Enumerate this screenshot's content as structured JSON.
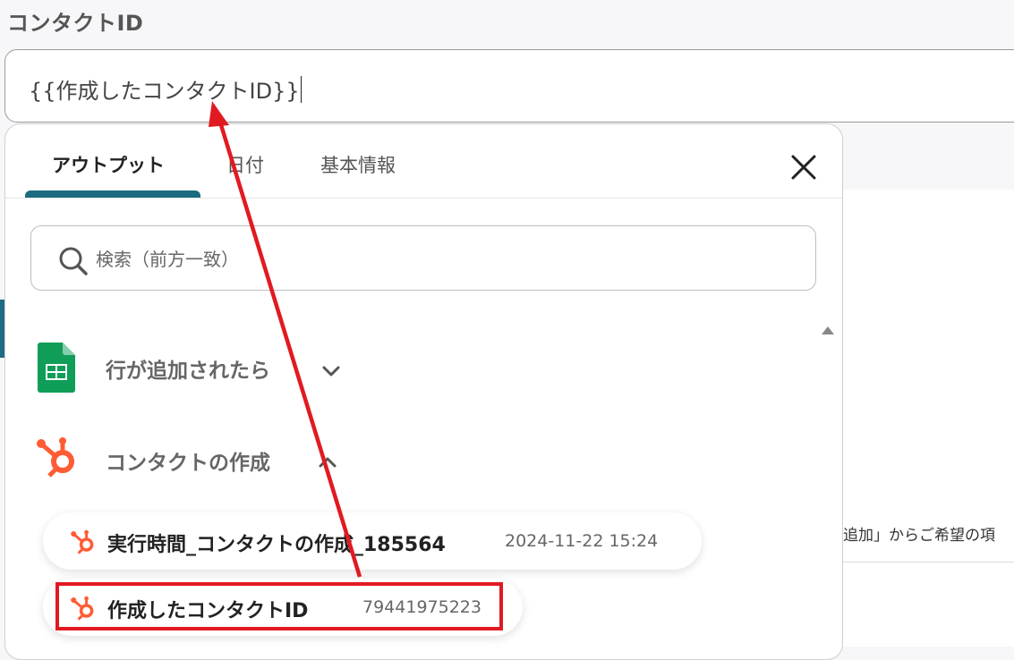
{
  "field": {
    "label": "コンタクトID",
    "value": "{{作成したコンタクトID}}"
  },
  "dropdown": {
    "tabs": [
      {
        "label": "アウトプット",
        "active": true
      },
      {
        "label": "日付",
        "active": false
      },
      {
        "label": "基本情報",
        "active": false
      }
    ],
    "search_placeholder": "検索（前方一致）",
    "sections": [
      {
        "title": "行が追加されたら",
        "expanded": false,
        "icon": "google-sheets-icon"
      },
      {
        "title": "コンタクトの作成",
        "expanded": true,
        "icon": "hubspot-icon"
      }
    ],
    "items": [
      {
        "label": "実行時間_コンタクトの作成_185564",
        "value": "2024-11-22 15:24",
        "icon": "hubspot-icon"
      },
      {
        "label": "作成したコンタクトID",
        "value": "79441975223",
        "icon": "hubspot-icon",
        "highlighted": true
      }
    ]
  },
  "background": {
    "right_snippet": "追加」からご希望の項"
  },
  "colors": {
    "accent": "#1d6b80",
    "hubspot": "#ff5c35",
    "sheets": "#0f9d58",
    "annotation": "#e11a22"
  }
}
